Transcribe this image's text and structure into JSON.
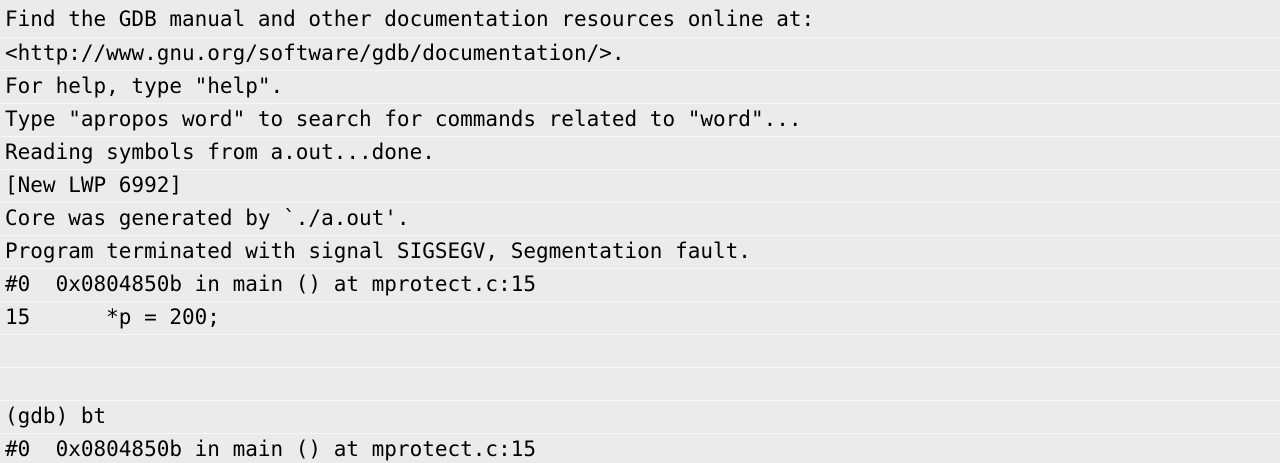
{
  "terminal": {
    "lines": [
      "Find the GDB manual and other documentation resources online at:",
      "<http://www.gnu.org/software/gdb/documentation/>.",
      "For help, type \"help\".",
      "Type \"apropos word\" to search for commands related to \"word\"...",
      "Reading symbols from a.out...done.",
      "[New LWP 6992]",
      "Core was generated by `./a.out'.",
      "Program terminated with signal SIGSEGV, Segmentation fault.",
      "#0  0x0804850b in main () at mprotect.c:15",
      "15      *p = 200;",
      "",
      "",
      "(gdb) bt",
      "#0  0x0804850b in main () at mprotect.c:15"
    ]
  }
}
